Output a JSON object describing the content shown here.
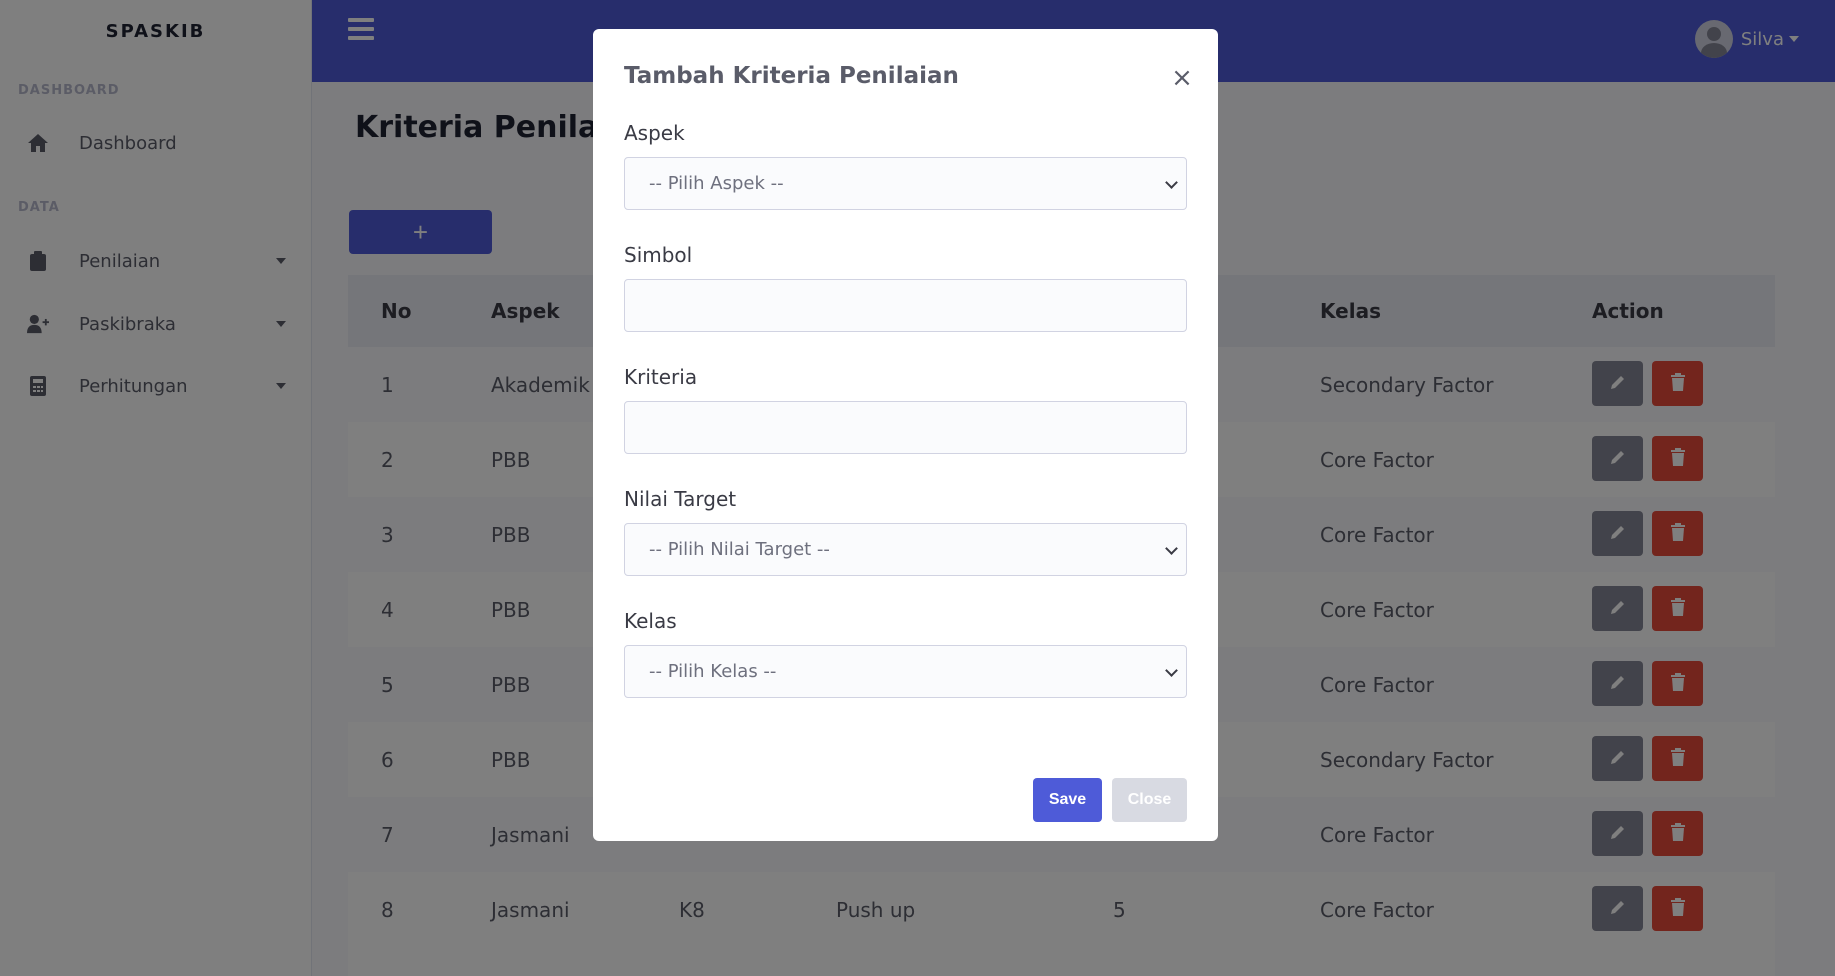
{
  "app": {
    "brand": "SPASKIB"
  },
  "sidebar": {
    "sections": [
      {
        "heading": "DASHBOARD"
      },
      {
        "heading": "DATA"
      }
    ],
    "items": [
      {
        "label": "Dashboard",
        "icon": "home-icon"
      },
      {
        "label": "Penilaian",
        "icon": "clipboard-icon"
      },
      {
        "label": "Paskibraka",
        "icon": "user-plus-icon"
      },
      {
        "label": "Perhitungan",
        "icon": "calculator-icon"
      }
    ]
  },
  "topbar": {
    "user_name": "Silva"
  },
  "main": {
    "page_title": "Kriteria Penilaian",
    "add_label": "+",
    "table": {
      "headers": [
        "No",
        "Aspek",
        "Kelas",
        "Action"
      ],
      "rows": [
        {
          "no": "1",
          "aspek": "Akademik",
          "simbol": "",
          "kriteria": "",
          "nilai": "",
          "kelas": "Secondary Factor"
        },
        {
          "no": "2",
          "aspek": "PBB",
          "simbol": "",
          "kriteria": "",
          "nilai": "",
          "kelas": "Core Factor"
        },
        {
          "no": "3",
          "aspek": "PBB",
          "simbol": "",
          "kriteria": "",
          "nilai": "",
          "kelas": "Core Factor"
        },
        {
          "no": "4",
          "aspek": "PBB",
          "simbol": "",
          "kriteria": "",
          "nilai": "",
          "kelas": "Core Factor"
        },
        {
          "no": "5",
          "aspek": "PBB",
          "simbol": "",
          "kriteria": "",
          "nilai": "",
          "kelas": "Core Factor"
        },
        {
          "no": "6",
          "aspek": "PBB",
          "simbol": "",
          "kriteria": "",
          "nilai": "",
          "kelas": "Secondary Factor"
        },
        {
          "no": "7",
          "aspek": "Jasmani",
          "simbol": "",
          "kriteria": "",
          "nilai": "",
          "kelas": "Core Factor"
        },
        {
          "no": "8",
          "aspek": "Jasmani",
          "simbol": "K8",
          "kriteria": "Push up",
          "nilai": "5",
          "kelas": "Core Factor"
        }
      ]
    }
  },
  "modal": {
    "title": "Tambah Kriteria Penilaian",
    "close_symbol": "×",
    "fields": {
      "aspek": {
        "label": "Aspek",
        "value": "-- Pilih Aspek --"
      },
      "simbol": {
        "label": "Simbol",
        "value": ""
      },
      "kriteria": {
        "label": "Kriteria",
        "value": ""
      },
      "nilai_target": {
        "label": "Nilai Target",
        "value": "-- Pilih Nilai Target --"
      },
      "kelas": {
        "label": "Kelas",
        "value": "-- Pilih Kelas --"
      }
    },
    "save_label": "Save",
    "close_label": "Close"
  },
  "colors": {
    "primary": "#4e5bd8",
    "danger": "#e74a3b",
    "secondary": "#858796"
  }
}
